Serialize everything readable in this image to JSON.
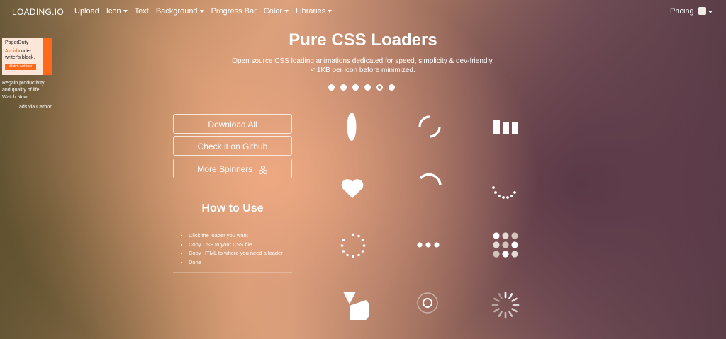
{
  "nav": {
    "logo": "LOADING.IO",
    "items": [
      {
        "label": "Upload",
        "dropdown": false
      },
      {
        "label": "Icon",
        "dropdown": true
      },
      {
        "label": "Text",
        "dropdown": false
      },
      {
        "label": "Background",
        "dropdown": true
      },
      {
        "label": "Progress Bar",
        "dropdown": false
      },
      {
        "label": "Color",
        "dropdown": true
      },
      {
        "label": "Libraries",
        "dropdown": true
      }
    ],
    "pricing": "Pricing"
  },
  "ad": {
    "brand": "PagerDuty",
    "headline_highlight": "Avoid",
    "headline_rest": "code-writer's block.",
    "cta": "Watch webinar",
    "text": "Regain productivity and quality of life. Watch Now.",
    "via": "ads via Carbon"
  },
  "hero": {
    "title": "Pure CSS Loaders",
    "subtitle_line1": "Open source CSS loading animations dedicated for speed, simplicity & dev-friendly.",
    "subtitle_line2": "< 1KB per icon before minimized."
  },
  "buttons": {
    "download": "Download All",
    "github": "Check it on Github",
    "spinners": "More Spinners"
  },
  "howto": {
    "title": "How to Use",
    "steps": [
      "Click the loader you want",
      "Copy CSS to your CSS file",
      "Copy HTML to where you need a loader",
      "Done"
    ]
  },
  "loaders": [
    "circle",
    "dual-ring",
    "facebook",
    "heart",
    "ring",
    "roller",
    "default",
    "ellipsis",
    "grid",
    "hourglass",
    "ripple",
    "spinner"
  ]
}
